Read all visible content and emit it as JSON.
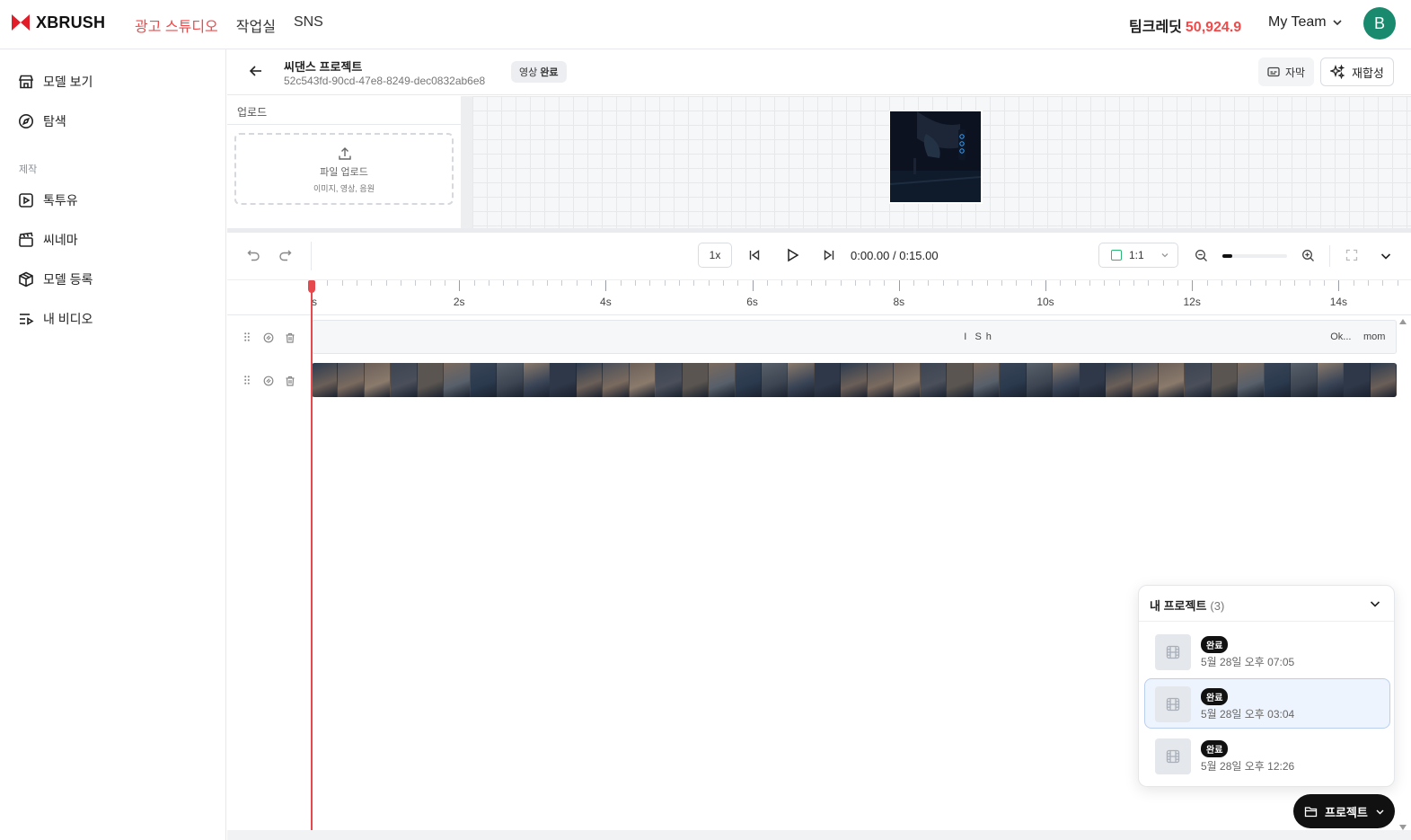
{
  "brand": {
    "name": "XBRUSH",
    "accent": "#f04a4a"
  },
  "topnav": {
    "items": [
      "광고 스튜디오",
      "작업실",
      "SNS"
    ],
    "active": "광고 스튜디오"
  },
  "credit": {
    "label": "팀크레딧",
    "value": "50,924.9"
  },
  "team": {
    "name": "My Team"
  },
  "avatar": {
    "initial": "B",
    "color": "#1a8a6e"
  },
  "sidebar": {
    "items": [
      {
        "label": "모델 보기",
        "icon": "store-icon"
      },
      {
        "label": "탐색",
        "icon": "compass-icon"
      }
    ],
    "section": "제작",
    "make_items": [
      {
        "label": "톡투유",
        "icon": "play-square-icon"
      },
      {
        "label": "씨네마",
        "icon": "clapperboard-icon"
      },
      {
        "label": "모델 등록",
        "icon": "package-icon"
      },
      {
        "label": "내 비디오",
        "icon": "playlist-icon"
      }
    ]
  },
  "project": {
    "title": "씨댄스 프로젝트",
    "id": "52c543fd-90cd-47e8-8249-dec0832ab6e8",
    "status_prefix": "영상",
    "status": "완료",
    "subtitle_btn": "자막",
    "recompose_btn": "재합성"
  },
  "upload": {
    "label": "업로드",
    "title": "파일 업로드",
    "subtitle": "이미지, 영상, 음원"
  },
  "toolbar": {
    "speed": "1x",
    "timecode": "0:00.00 / 0:15.00",
    "ratio": "1:1",
    "zoom_level": 0.15
  },
  "timeline": {
    "ruler_labels": [
      "s",
      "2s",
      "4s",
      "6s",
      "8s",
      "10s",
      "12s",
      "14s"
    ],
    "subtitle_track": [
      {
        "text": "I",
        "time": 8.9
      },
      {
        "text": "S",
        "time": 9.05
      },
      {
        "text": "h",
        "time": 9.2
      },
      {
        "text": "Ok...",
        "time": 13.9
      },
      {
        "text": "mom",
        "time": 14.35
      }
    ],
    "duration_s": 15
  },
  "projects_popup": {
    "title": "내 프로젝트",
    "count": "(3)",
    "items": [
      {
        "badge": "완료",
        "date": "5월 28일 오후 07:05",
        "selected": false
      },
      {
        "badge": "완료",
        "date": "5월 28일 오후 03:04",
        "selected": true
      },
      {
        "badge": "완료",
        "date": "5월 28일 오후 12:26",
        "selected": false
      }
    ]
  },
  "project_button": {
    "label": "프로젝트"
  }
}
